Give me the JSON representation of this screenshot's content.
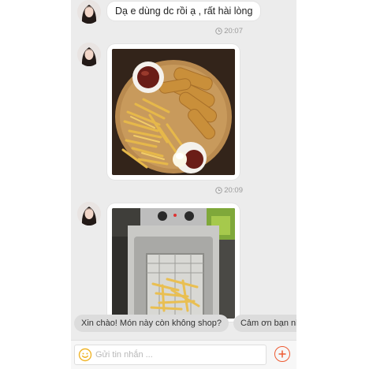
{
  "messages": [
    {
      "type": "text",
      "text": "Dạ e dùng dc rồi ạ , rất hài lòng",
      "time": "20:07"
    },
    {
      "type": "image",
      "image_icon": "photo-fries-platter",
      "time": "20:09"
    },
    {
      "type": "image",
      "image_icon": "photo-deep-fryer"
    }
  ],
  "quick_replies": [
    "Xin chào! Món này còn không shop?",
    "Cảm ơn bạn nh"
  ],
  "composer": {
    "placeholder": "Gửi tin nhắn ...",
    "emoji_icon": "smiley-icon",
    "add_icon": "plus-circle-icon",
    "accent_color": "#ee5b33"
  },
  "colors": {
    "chat_background": "#ececec",
    "bubble": "#ffffff",
    "chip": "#dcdcdc",
    "timestamp": "#9a9a9a"
  }
}
